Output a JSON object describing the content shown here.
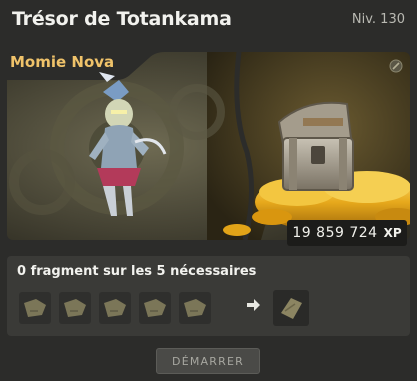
{
  "header": {
    "title": "Trésor de Totankama",
    "level": "Niv. 130"
  },
  "monster": {
    "name": "Momie Nova"
  },
  "reward": {
    "xp_value": "19 859 724",
    "xp_unit": "XP"
  },
  "fragments": {
    "status": "0 fragment sur les 5 nécessaires",
    "collected": 0,
    "required": 5
  },
  "actions": {
    "start_label": "DÉMARRER"
  },
  "colors": {
    "subtitle": "#f0c36a",
    "panel": "#2c2c2a",
    "gold": "#e0a820"
  },
  "icons": [
    "lock-icon",
    "fragment-icon",
    "arrow-right-icon",
    "map-scroll-icon",
    "treasure-chest-icon"
  ]
}
